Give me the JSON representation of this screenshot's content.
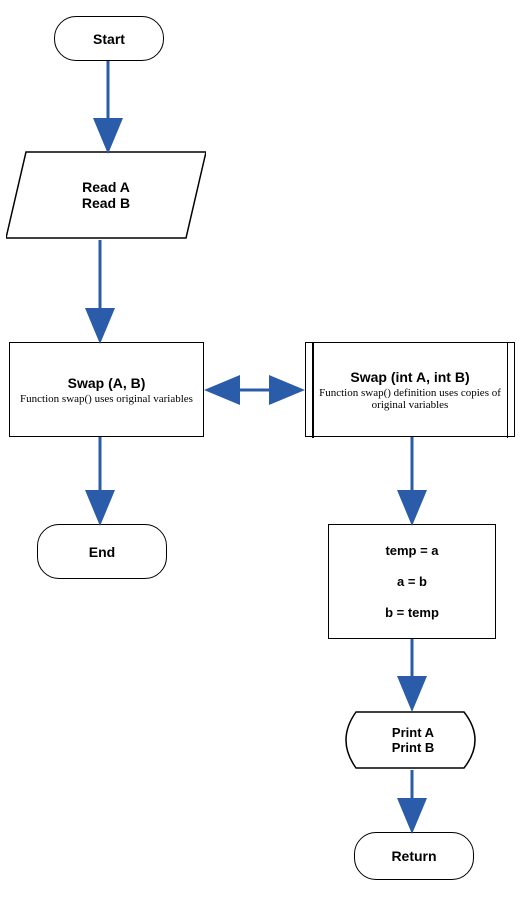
{
  "chart_data": {
    "type": "flowchart",
    "nodes": [
      {
        "id": "start",
        "shape": "terminator",
        "label": "Start"
      },
      {
        "id": "read",
        "shape": "data",
        "lines": [
          "Read A",
          "Read B"
        ]
      },
      {
        "id": "swap_call",
        "shape": "process",
        "title": "Swap (A, B)",
        "subtitle": "Function swap() uses original variables"
      },
      {
        "id": "swap_def",
        "shape": "predefined-process",
        "title": "Swap (int A, int B)",
        "subtitle": "Function swap() definition uses copies of original variables"
      },
      {
        "id": "end",
        "shape": "terminator",
        "label": "End"
      },
      {
        "id": "assign",
        "shape": "process",
        "lines": [
          "temp = a",
          "a = b",
          "b = temp"
        ]
      },
      {
        "id": "print",
        "shape": "display",
        "lines": [
          "Print A",
          "Print B"
        ]
      },
      {
        "id": "return",
        "shape": "terminator",
        "label": "Return"
      }
    ],
    "edges": [
      {
        "from": "start",
        "to": "read"
      },
      {
        "from": "read",
        "to": "swap_call"
      },
      {
        "from": "swap_call",
        "to": "swap_def",
        "bidirectional": true
      },
      {
        "from": "swap_call",
        "to": "end"
      },
      {
        "from": "swap_def",
        "to": "assign"
      },
      {
        "from": "assign",
        "to": "print"
      },
      {
        "from": "print",
        "to": "return"
      }
    ]
  },
  "labels": {
    "start": "Start",
    "read_a": "Read A",
    "read_b": "Read B",
    "swap_call_title": "Swap (A, B)",
    "swap_call_sub": "Function swap() uses original variables",
    "swap_def_title": "Swap (int A, int B)",
    "swap_def_sub": "Function swap() definition uses copies of original variables",
    "end": "End",
    "assign_1": "temp = a",
    "assign_2": "a = b",
    "assign_3": "b = temp",
    "print_a": "Print A",
    "print_b": "Print B",
    "return": "Return"
  },
  "colors": {
    "arrow": "#2a5caa"
  }
}
